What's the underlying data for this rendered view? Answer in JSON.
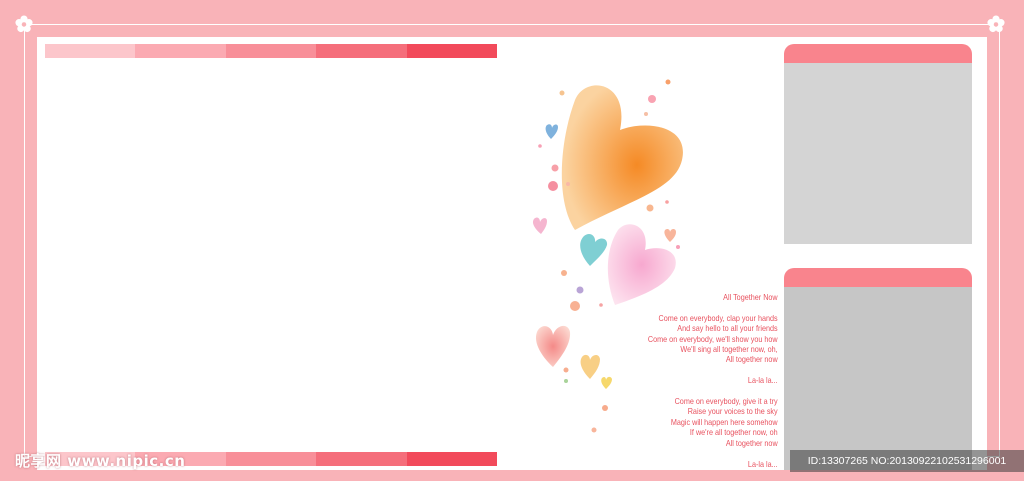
{
  "colors": {
    "background": "#f9b3b8",
    "panel": "#ffffff",
    "bar_segments": [
      "#fcc6cb",
      "#fbaab2",
      "#f88f99",
      "#f56e7b",
      "#f24a5b"
    ],
    "frame_header": "#f9848d",
    "frame_body_top": "#d4d4d4",
    "frame_body_bottom": "#c6c6c6",
    "lyrics_text": "#e8525f"
  },
  "lyrics": {
    "title": "All Together Now",
    "verse1": [
      "Come on everybody, clap your hands",
      "And say hello to all your friends",
      "Come on everybody, we'll show you how",
      "We'll sing all together now, oh,",
      "All together now"
    ],
    "refrain1": "La-la la...",
    "verse2": [
      "Come on everybody, give it a try",
      "Raise your voices to the sky",
      "Magic will happen here somehow",
      "If we're all together now, oh",
      "All together now"
    ],
    "refrain2": "La-la la..."
  },
  "watermark": {
    "site": "昵享网 www.nipic.cn",
    "id_text": "ID:13307265 NO:20130922102531296001"
  },
  "icons": [
    "flower-icon",
    "heart-icon"
  ]
}
